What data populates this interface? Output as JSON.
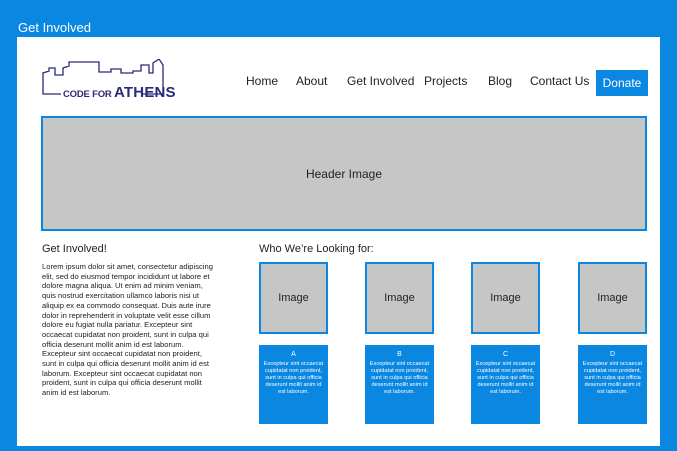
{
  "window": {
    "title": "Get Involved"
  },
  "logo": {
    "prefix": "CODE FOR",
    "name": "ATHENS"
  },
  "nav": {
    "items": [
      {
        "label": "Home"
      },
      {
        "label": "About"
      },
      {
        "label": "Get Involved"
      },
      {
        "label": "Projects"
      },
      {
        "label": "Blog"
      },
      {
        "label": "Contact Us"
      }
    ],
    "donate_label": "Donate"
  },
  "hero": {
    "label": "Header Image"
  },
  "intro": {
    "heading": "Get Involved!",
    "body": "Lorem ipsum dolor sit amet, consectetur adipiscing elit, sed do eiusmod tempor incididunt ut labore et dolore magna aliqua. Ut enim ad minim veniam, quis nostrud exercitation ullamco laboris nisi ut aliquip ex ea commodo consequat. Duis aute irure dolor in reprehenderit in voluptate velit esse cillum dolore eu fugiat nulla pariatur. Excepteur sint occaecat cupidatat non proident, sunt in culpa qui officia deserunt mollit anim id est laborum. Excepteur sint occaecat cupidatat non proident, sunt in culpa qui officia deserunt mollit anim id est laborum. Excepteur sint occaecat cupidatat non proident, sunt in culpa qui officia deserunt mollit anim id est laborum."
  },
  "looking": {
    "heading": "Who We’re Looking for:",
    "cards": [
      {
        "image_label": "Image",
        "letter": "A",
        "text": "Excepteur sint occaecat cupidatat non proident, sunt in culpa qui officia deserunt mollit anim id est laborum."
      },
      {
        "image_label": "Image",
        "letter": "B",
        "text": "Excepteur sint occaecat cupidatat non proident, sunt in culpa qui officia deserunt mollit anim id est laborum."
      },
      {
        "image_label": "Image",
        "letter": "C",
        "text": "Excepteur sint occaecat cupidatat non proident, sunt in culpa qui officia deserunt mollit anim id est laborum."
      },
      {
        "image_label": "Image",
        "letter": "D",
        "text": "Excepteur sint occaecat cupidatat non proident, sunt in culpa qui officia deserunt mollit anim id est laborum."
      }
    ]
  },
  "colors": {
    "accent": "#0a87e0",
    "placeholder": "#c6c6c6",
    "logo": "#2b2a7a"
  }
}
